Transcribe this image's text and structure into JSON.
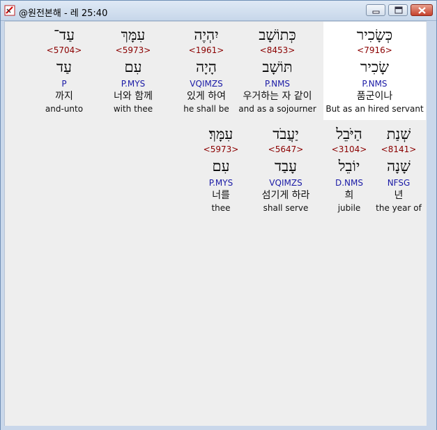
{
  "window": {
    "title": "@원전본해 - 레 25:40",
    "icon": "app-logo-icon"
  },
  "controls": {
    "minimize": "minimize-icon",
    "maximize": "maximize-icon",
    "close": "close-icon"
  },
  "words": [
    {
      "hebrew": "כְּשָׂכִיר",
      "strong": "<7916>",
      "lemma": "שָׂכִיר",
      "parse": "P.NMS",
      "korean": "품군이나",
      "english": "But as an hired servant"
    },
    {
      "hebrew": "כְּתוֹשָׁב",
      "strong": "<8453>",
      "lemma": "תּוֹשָׁב",
      "parse": "P.NMS",
      "korean": "우거하는 자 같이",
      "english": "and as a sojourner"
    },
    {
      "hebrew": "יִהְיֶה",
      "strong": "<1961>",
      "lemma": "הָיָה",
      "parse": "VQIMZS",
      "korean": "있게 하여",
      "english": "he shall be"
    },
    {
      "hebrew": "עִמָּךְ",
      "strong": "<5973>",
      "lemma": "עִם",
      "parse": "P.MYS",
      "korean": "너와 함께",
      "english": "with thee"
    },
    {
      "hebrew": "עַד־",
      "strong": "<5704>",
      "lemma": "עַד",
      "parse": "P",
      "korean": "까지",
      "english": "and-unto"
    },
    {
      "hebrew": "שְׁנַת",
      "strong": "<8141>",
      "lemma": "שָׁנָה",
      "parse": "NFSG",
      "korean": "년",
      "english": "the year of"
    },
    {
      "hebrew": "הַיֹּבֵל",
      "strong": "<3104>",
      "lemma": "יוֹבֵל",
      "parse": "D.NMS",
      "korean": "희",
      "english": "jubile"
    },
    {
      "hebrew": "יַעֲבֹד",
      "strong": "<5647>",
      "lemma": "עָבַד",
      "parse": "VQIMZS",
      "korean": "섬기게 하라",
      "english": "shall serve"
    },
    {
      "hebrew": "עִמָּךְ׃",
      "strong": "<5973>",
      "lemma": "עִם",
      "parse": "P.MYS",
      "korean": "너를",
      "english": "thee"
    }
  ]
}
